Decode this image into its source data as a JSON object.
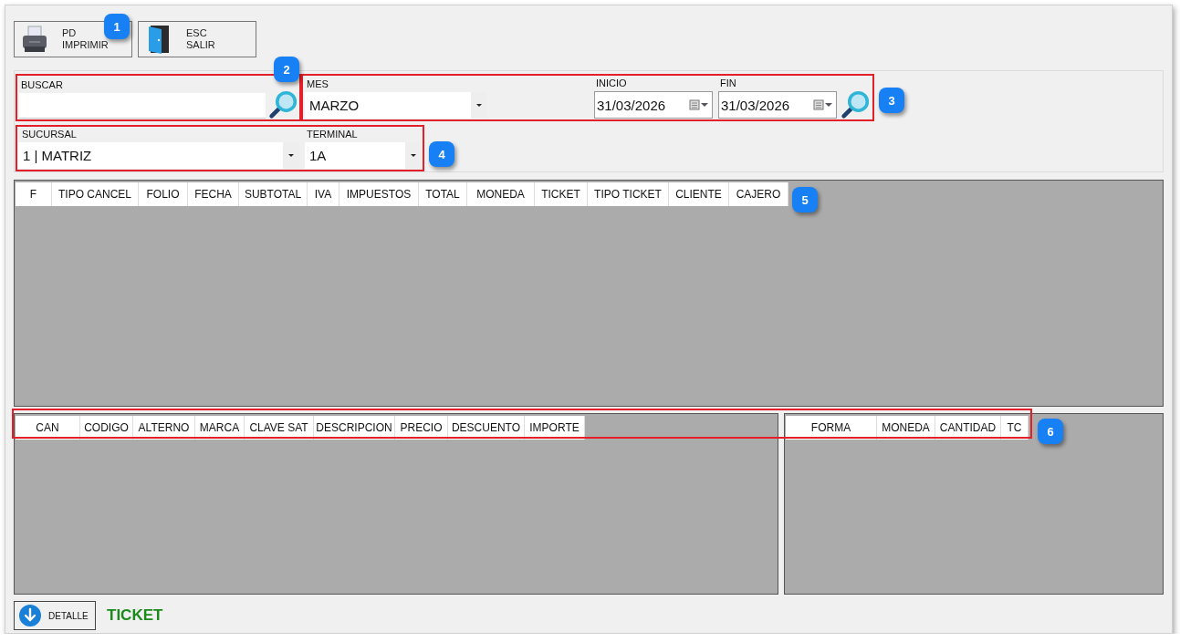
{
  "toolbar": [
    {
      "kind": "print",
      "shortcut": "PD",
      "label": "IMPRIMIR"
    },
    {
      "kind": "exit",
      "shortcut": "ESC",
      "label": "SALIR"
    }
  ],
  "filters": {
    "search": {
      "label": "BUSCAR"
    },
    "month": {
      "label": "MES",
      "value": "MARZO"
    },
    "start": {
      "label": "INICIO",
      "value": "31/03/2026"
    },
    "end": {
      "label": "FIN",
      "value": "31/03/2026"
    },
    "branch": {
      "label": "SUCURSAL",
      "value": "1 | MATRIZ"
    },
    "terminal": {
      "label": "TERMINAL",
      "value": "1A"
    }
  },
  "tickets_table": {
    "columns": [
      "F",
      "TIPO CANCEL",
      "FOLIO",
      "FECHA",
      "SUBTOTAL",
      "IVA",
      "IMPUESTOS",
      "TOTAL",
      "MONEDA",
      "TICKET",
      "TIPO TICKET",
      "CLIENTE",
      "CAJERO"
    ]
  },
  "detail_table": {
    "columns": [
      "CAN",
      "CODIGO",
      "ALTERNO",
      "MARCA",
      "CLAVE SAT",
      "DESCRIPCION",
      "PRECIO",
      "DESCUENTO",
      "IMPORTE"
    ]
  },
  "payments_table": {
    "columns": [
      "FORMA",
      "MONEDA",
      "CANTIDAD",
      "TC"
    ]
  },
  "footer": {
    "button": "DETALLE",
    "title": "TICKET"
  },
  "callouts": [
    "1",
    "2",
    "3",
    "4",
    "5",
    "6"
  ]
}
